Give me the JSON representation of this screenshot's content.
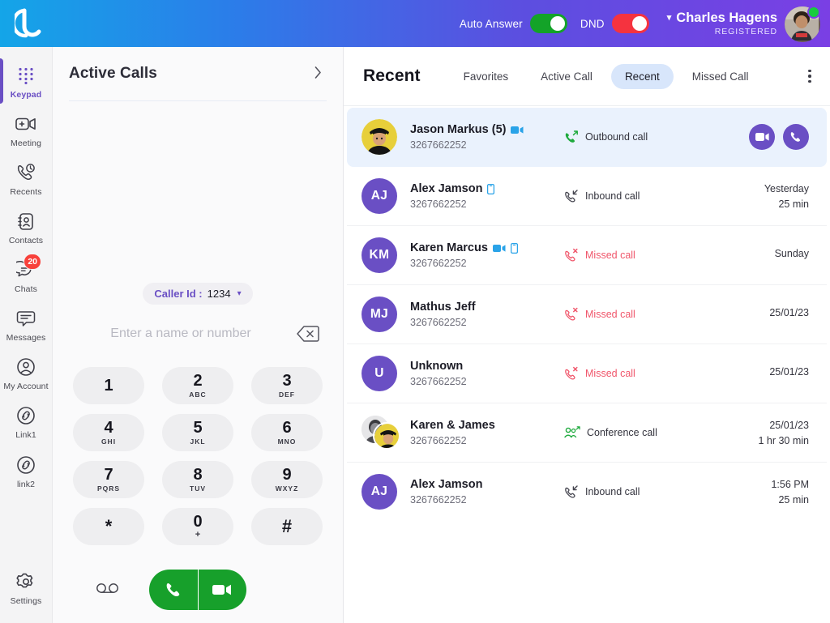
{
  "topbar": {
    "logo_name": "brand-logo",
    "auto_answer": {
      "label": "Auto Answer",
      "state": "on",
      "color": "#13a328"
    },
    "dnd": {
      "label": "DND",
      "state": "on",
      "color": "#f5333f"
    },
    "user": {
      "name": "Charles Hagens",
      "status": "REGISTERED",
      "presence": "online"
    },
    "gradient_from": "#14a5e8",
    "gradient_to": "#7a3fe4"
  },
  "rail": {
    "items": [
      {
        "label": "Keypad",
        "icon": "keypad-icon",
        "active": true,
        "badge": null
      },
      {
        "label": "Meeting",
        "icon": "video-plus-icon",
        "active": false,
        "badge": null
      },
      {
        "label": "Recents",
        "icon": "phone-clock-icon",
        "active": false,
        "badge": null
      },
      {
        "label": "Contacts",
        "icon": "contact-book-icon",
        "active": false,
        "badge": null
      },
      {
        "label": "Chats",
        "icon": "chat-bubble-icon",
        "active": false,
        "badge": "20"
      },
      {
        "label": "Messages",
        "icon": "message-lines-icon",
        "active": false,
        "badge": null
      },
      {
        "label": "My Account",
        "icon": "user-circle-icon",
        "active": false,
        "badge": null
      },
      {
        "label": "Link1",
        "icon": "link-circle-icon",
        "active": false,
        "badge": null
      },
      {
        "label": "link2",
        "icon": "link-circle-icon",
        "active": false,
        "badge": null
      }
    ],
    "settings": {
      "label": "Settings",
      "icon": "gear-icon"
    },
    "active_color": "#6a4fc4",
    "badge_color": "#f8413b"
  },
  "dialer": {
    "active_calls_title": "Active Calls",
    "expand_icon": "chevron-right-icon",
    "caller_id": {
      "key": "Caller Id :",
      "value": "1234",
      "caret": "chevron-down-icon"
    },
    "number_input": {
      "value": "",
      "placeholder": "Enter a name or number"
    },
    "backspace_icon": "backspace-icon",
    "keys": [
      {
        "digit": "1",
        "letters": ""
      },
      {
        "digit": "2",
        "letters": "ABC"
      },
      {
        "digit": "3",
        "letters": "DEF"
      },
      {
        "digit": "4",
        "letters": "GHI"
      },
      {
        "digit": "5",
        "letters": "JKL"
      },
      {
        "digit": "6",
        "letters": "MNO"
      },
      {
        "digit": "7",
        "letters": "PQRS"
      },
      {
        "digit": "8",
        "letters": "TUV"
      },
      {
        "digit": "9",
        "letters": "WXYZ"
      },
      {
        "digit": "*",
        "letters": ""
      },
      {
        "digit": "0",
        "letters": "+"
      },
      {
        "digit": "#",
        "letters": ""
      }
    ],
    "voicemail_icon": "voicemail-icon",
    "audio_call_icon": "phone-icon",
    "video_call_icon": "video-icon",
    "call_button_color": "#17a02b"
  },
  "recent": {
    "title": "Recent",
    "tabs": [
      {
        "label": "Favorites",
        "active": false
      },
      {
        "label": "Active Call",
        "active": false
      },
      {
        "label": "Recent",
        "active": true
      },
      {
        "label": "Missed Call",
        "active": false
      }
    ],
    "menu_icon": "kebab-menu-icon",
    "active_tab_color": "#d8e6fb",
    "rows": [
      {
        "name": "Jason Markus (5)",
        "number": "3267662252",
        "avatar_type": "photo-yellow",
        "initials": "",
        "tags": [
          "video-icon"
        ],
        "call_type": "Outbound call",
        "call_icon": "outbound-call-icon",
        "missed": false,
        "time": "",
        "duration": "",
        "selected": true,
        "actions": [
          "video-call-button",
          "audio-call-button"
        ]
      },
      {
        "name": "Alex Jamson",
        "number": "3267662252",
        "avatar_type": "initials",
        "initials": "AJ",
        "tags": [
          "mobile-icon"
        ],
        "call_type": "Inbound call",
        "call_icon": "inbound-call-icon",
        "missed": false,
        "time": "Yesterday",
        "duration": "25 min",
        "selected": false,
        "actions": []
      },
      {
        "name": "Karen Marcus",
        "number": "3267662252",
        "avatar_type": "initials",
        "initials": "KM",
        "tags": [
          "video-icon",
          "mobile-icon"
        ],
        "call_type": "Missed call",
        "call_icon": "missed-call-icon",
        "missed": true,
        "time": "Sunday",
        "duration": "",
        "selected": false,
        "actions": []
      },
      {
        "name": "Mathus Jeff",
        "number": "3267662252",
        "avatar_type": "initials",
        "initials": "MJ",
        "tags": [],
        "call_type": "Missed call",
        "call_icon": "missed-call-icon",
        "missed": true,
        "time": "25/01/23",
        "duration": "",
        "selected": false,
        "actions": []
      },
      {
        "name": "Unknown",
        "number": "3267662252",
        "avatar_type": "initials",
        "initials": "U",
        "tags": [],
        "call_type": "Missed call",
        "call_icon": "missed-call-icon",
        "missed": true,
        "time": "25/01/23",
        "duration": "",
        "selected": false,
        "actions": []
      },
      {
        "name": "Karen & James",
        "number": "3267662252",
        "avatar_type": "dual-photo",
        "initials": "",
        "tags": [],
        "call_type": "Conference call",
        "call_icon": "conference-call-icon",
        "missed": false,
        "time": "25/01/23",
        "duration": "1 hr 30 min",
        "selected": false,
        "actions": []
      },
      {
        "name": "Alex Jamson",
        "number": "3267662252",
        "avatar_type": "initials",
        "initials": "AJ",
        "tags": [],
        "call_type": "Inbound call",
        "call_icon": "inbound-call-icon",
        "missed": false,
        "time": "1:56 PM",
        "duration": "25 min",
        "selected": false,
        "actions": []
      }
    ]
  }
}
